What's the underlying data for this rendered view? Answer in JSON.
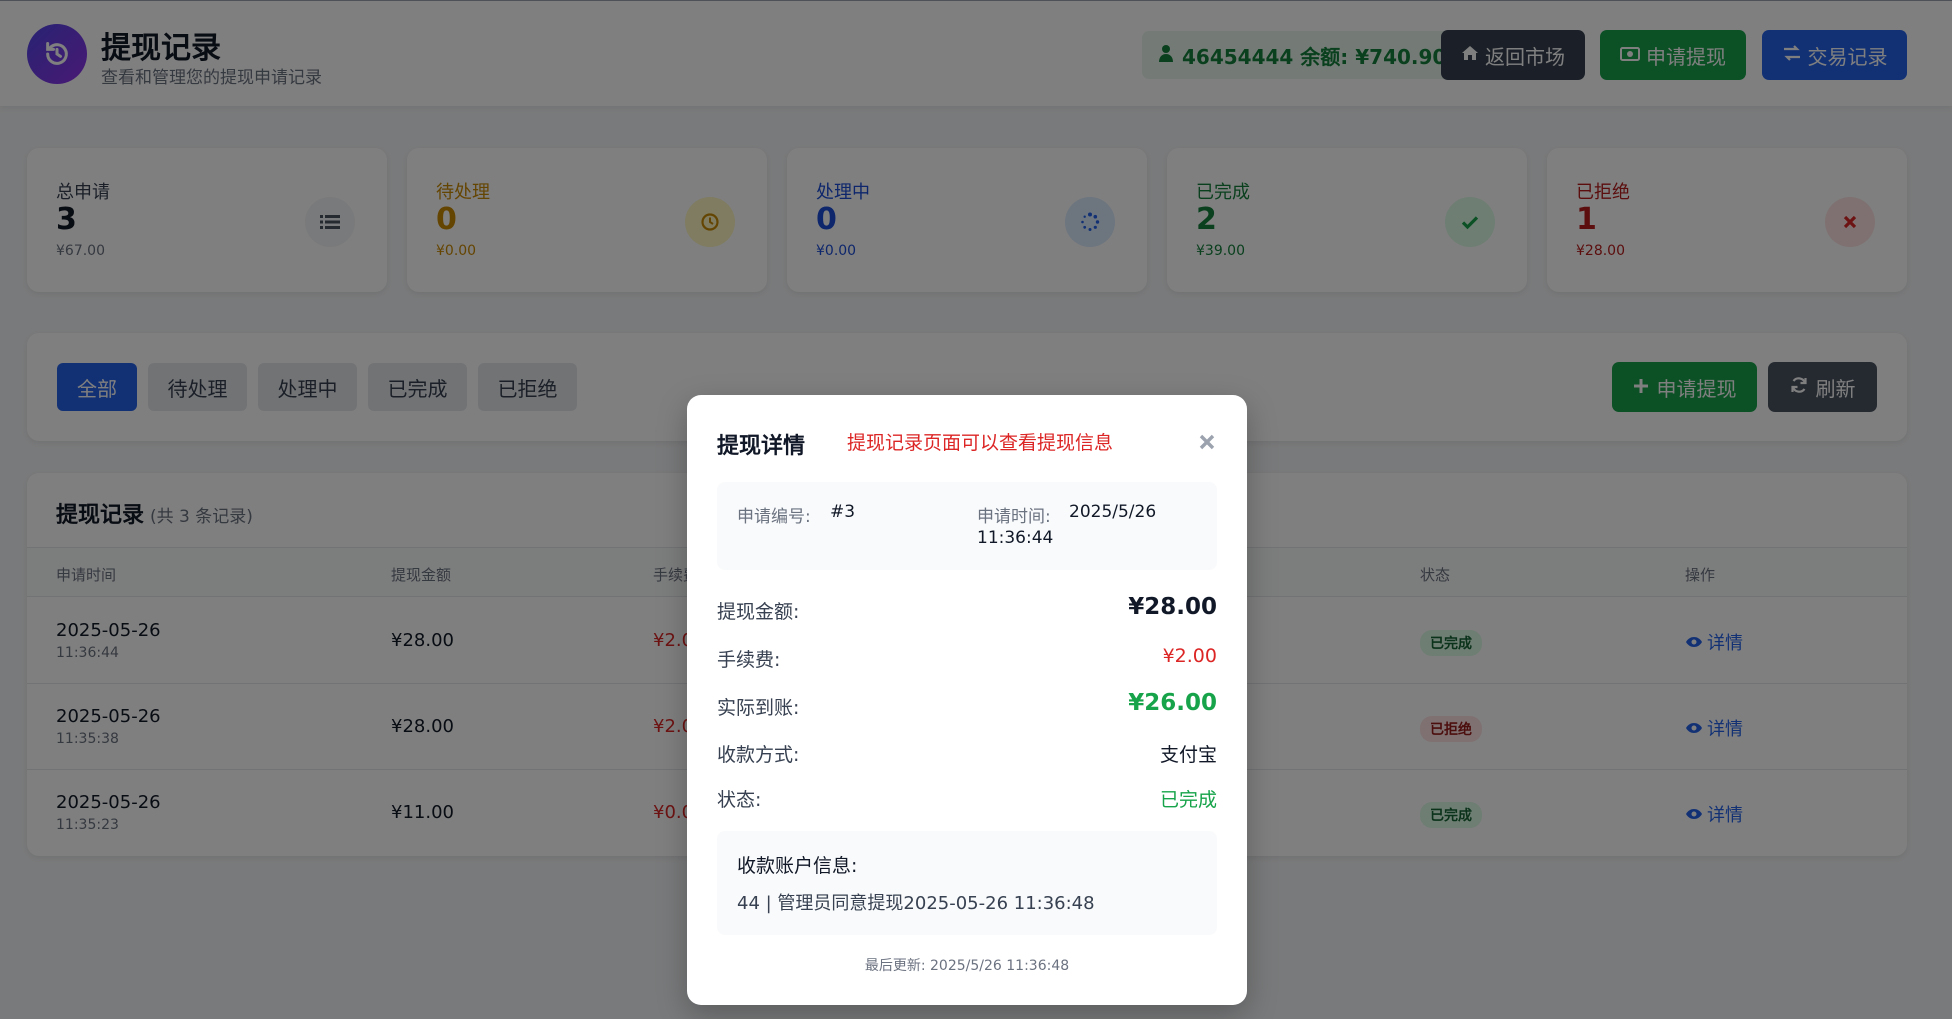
{
  "header": {
    "title": "提现记录",
    "subtitle": "查看和管理您的提现申请记录",
    "balance_text": "46454444 余额: ¥740.90",
    "buttons": {
      "market": "返回市场",
      "withdraw": "申请提现",
      "transactions": "交易记录"
    }
  },
  "stats": [
    {
      "label": "总申请",
      "count": "3",
      "amount": "¥67.00"
    },
    {
      "label": "待处理",
      "count": "0",
      "amount": "¥0.00"
    },
    {
      "label": "处理中",
      "count": "0",
      "amount": "¥0.00"
    },
    {
      "label": "已完成",
      "count": "2",
      "amount": "¥39.00"
    },
    {
      "label": "已拒绝",
      "count": "1",
      "amount": "¥28.00"
    }
  ],
  "filters": {
    "tabs": [
      "全部",
      "待处理",
      "处理中",
      "已完成",
      "已拒绝"
    ],
    "apply_button": "申请提现",
    "refresh_button": "刷新"
  },
  "table": {
    "title": "提现记录",
    "count_text": "(共 3 条记录)",
    "headers": {
      "time": "申请时间",
      "amount": "提现金额",
      "fee": "手续费",
      "status": "状态",
      "action": "操作"
    },
    "rows": [
      {
        "date": "2025-05-26",
        "time": "11:36:44",
        "amount": "¥28.00",
        "fee": "¥2.0",
        "status": "已完成",
        "action": "详情"
      },
      {
        "date": "2025-05-26",
        "time": "11:35:38",
        "amount": "¥28.00",
        "fee": "¥2.0",
        "status": "已拒绝",
        "action": "详情"
      },
      {
        "date": "2025-05-26",
        "time": "11:35:23",
        "amount": "¥11.00",
        "fee": "¥0.0",
        "status": "已完成",
        "action": "详情"
      }
    ]
  },
  "modal": {
    "title": "提现详情",
    "note": "提现记录页面可以查看提现信息",
    "id_label": "申请编号:",
    "id_value": "#3",
    "time_label": "申请时间:",
    "time_value_date": "2025/5/26",
    "time_value_time": "11:36:44",
    "amount_label": "提现金额:",
    "amount_value": "¥28.00",
    "fee_label": "手续费:",
    "fee_value": "¥2.00",
    "actual_label": "实际到账:",
    "actual_value": "¥26.00",
    "method_label": "收款方式:",
    "method_value": "支付宝",
    "status_label": "状态:",
    "status_value": "已完成",
    "account_label": "收款账户信息:",
    "account_value": "44 | 管理员同意提现2025-05-26 11:36:48",
    "updated": "最后更新: 2025/5/26 11:36:48"
  },
  "colors": {
    "primary": "#2563eb",
    "success": "#16a34a",
    "danger": "#dc2626",
    "warning": "#ca8a04",
    "dark": "#374151"
  }
}
